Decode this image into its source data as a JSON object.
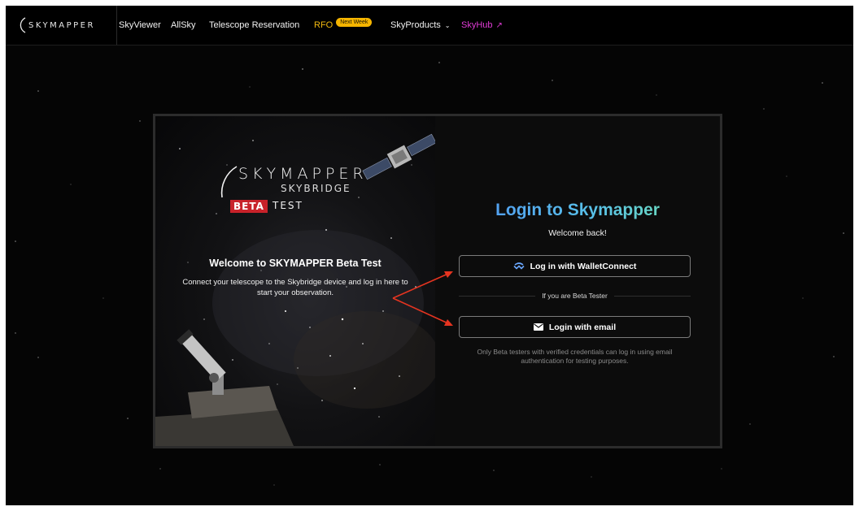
{
  "nav": {
    "logo_text": "SKYMAPPER",
    "links": [
      "SkyViewer",
      "AllSky",
      "Telescope Reservation"
    ],
    "rfo_label": "RFO",
    "rfo_badge": "Next Week",
    "skyproducts_label": "SkyProducts",
    "skyhub_label": "SkyHub"
  },
  "left_panel": {
    "brand_main": "SKYMAPPER",
    "brand_sub": "SKYBRIDGE",
    "beta_label": "BETA",
    "test_label": "TEST",
    "welcome_title": "Welcome to SKYMAPPER Beta Test",
    "welcome_text": "Connect your telescope to the Skybridge device and log in here to start your observation."
  },
  "login": {
    "title": "Login to Skymapper",
    "subtitle": "Welcome back!",
    "walletconnect_label": "Log in with WalletConnect",
    "divider_text": "If you are Beta Tester",
    "email_label": "Login with email",
    "note": "Only Beta testers with verified credentials can log in using email authentication for testing purposes."
  },
  "colors": {
    "rfo": "#f1b90f",
    "skyhub": "#e23bd7",
    "beta_red": "#c8222a",
    "annotation_arrow": "#e53420"
  }
}
